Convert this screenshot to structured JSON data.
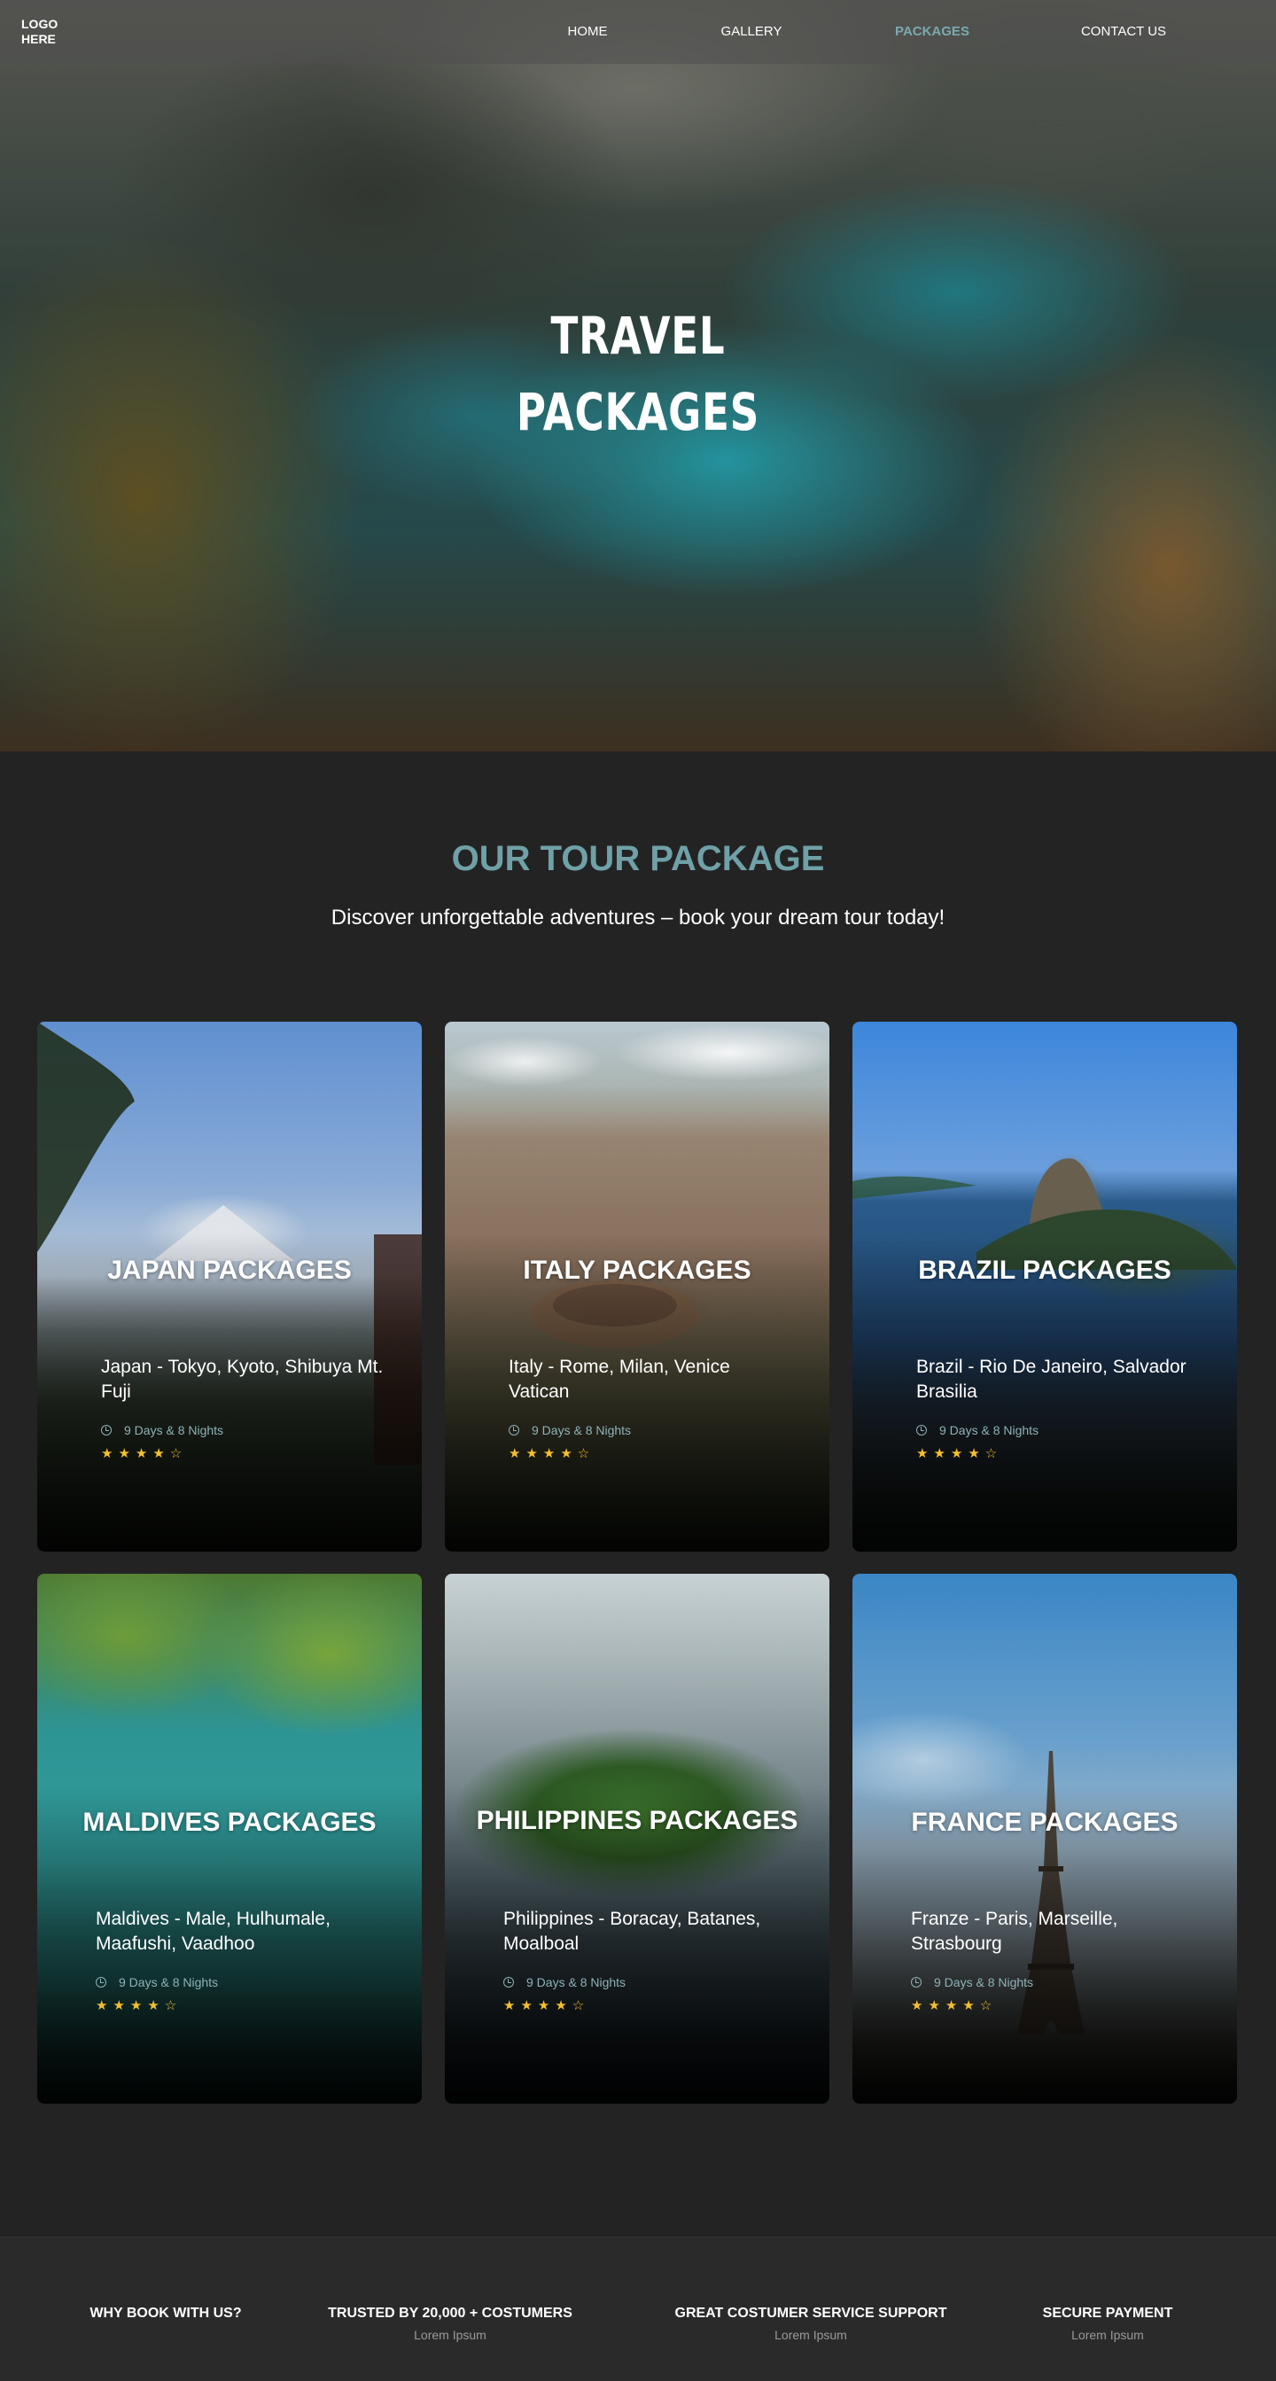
{
  "nav": {
    "logo": "LOGO HERE",
    "links": [
      "HOME",
      "GALLERY",
      "PACKAGES",
      "CONTACT US"
    ],
    "active": "PACKAGES"
  },
  "hero": {
    "title_line1": "TRAVEL",
    "title_line2": "PACKAGES"
  },
  "section": {
    "title": "OUR TOUR PACKAGE",
    "subtitle": "Discover unforgettable adventures – book your dream tour today!"
  },
  "packages": [
    {
      "title": "JAPAN PACKAGES",
      "cities": "Japan - Tokyo, Kyoto, Shibuya Mt. Fuji",
      "duration": "9 Days & 8 Nights",
      "stars": "★★★★☆",
      "rating": 4
    },
    {
      "title": "ITALY PACKAGES",
      "cities": "Italy - Rome, Milan, Venice Vatican",
      "duration": "9 Days & 8 Nights",
      "stars": "★★★★☆",
      "rating": 4
    },
    {
      "title": "BRAZIL PACKAGES",
      "cities": "Brazil - Rio De Janeiro, Salvador Brasilia",
      "duration": "9 Days & 8 Nights",
      "stars": "★★★★☆",
      "rating": 4
    },
    {
      "title": "MALDIVES PACKAGES",
      "cities": "Maldives - Male, Hulhumale, Maafushi, Vaadhoo",
      "duration": "9 Days & 8 Nights",
      "stars": "★★★★☆",
      "rating": 4
    },
    {
      "title": "PHILIPPINES PACKAGES",
      "cities": "Philippines - Boracay, Batanes, Moalboal",
      "duration": "9 Days & 8 Nights",
      "stars": "★★★★☆",
      "rating": 4
    },
    {
      "title": "FRANCE PACKAGES",
      "cities": "Franze - Paris, Marseille, Strasbourg",
      "duration": "9 Days & 8 Nights",
      "stars": "★★★★☆",
      "rating": 4
    }
  ],
  "footer": [
    {
      "title": "WHY BOOK WITH US?",
      "sub": ""
    },
    {
      "title": "TRUSTED BY 20,000 + COSTUMERS",
      "sub": "Lorem Ipsum"
    },
    {
      "title": "GREAT COSTUMER SERVICE SUPPORT",
      "sub": "Lorem Ipsum"
    },
    {
      "title": "SECURE PAYMENT",
      "sub": "Lorem Ipsum"
    }
  ],
  "colors": {
    "accent": "#6fa1a7",
    "background": "#232323",
    "star": "#f5c02e"
  },
  "icons": [
    "clock-icon",
    "star-icon"
  ]
}
